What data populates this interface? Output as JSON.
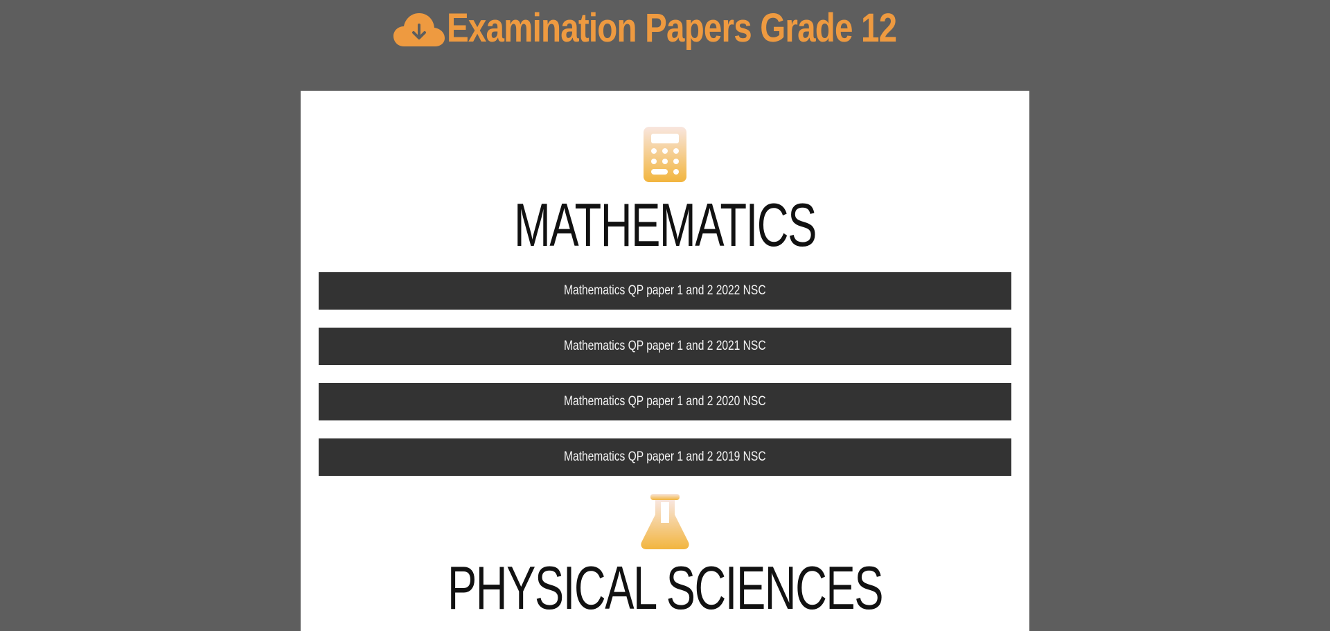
{
  "header": {
    "icon": "cloud-download-icon",
    "title": "Examination Papers Grade 12",
    "accent_color": "#ee9a40"
  },
  "subjects": [
    {
      "icon": "calculator-icon",
      "title": "MATHEMATICS",
      "papers": [
        "Mathematics QP paper 1 and 2 2022 NSC",
        "Mathematics QP paper 1 and 2 2021 NSC",
        "Mathematics QP paper 1 and 2 2020 NSC",
        "Mathematics QP paper 1 and 2 2019 NSC"
      ]
    },
    {
      "icon": "flask-icon",
      "title": "PHYSICAL SCIENCES"
    }
  ],
  "colors": {
    "page_background": "#5e5e5e",
    "panel_background": "#ffffff",
    "button_background": "#333333",
    "button_text": "#f5f5f5",
    "icon_gradient_top": "#f8e6df",
    "icon_gradient_bottom": "#f2b53e"
  }
}
